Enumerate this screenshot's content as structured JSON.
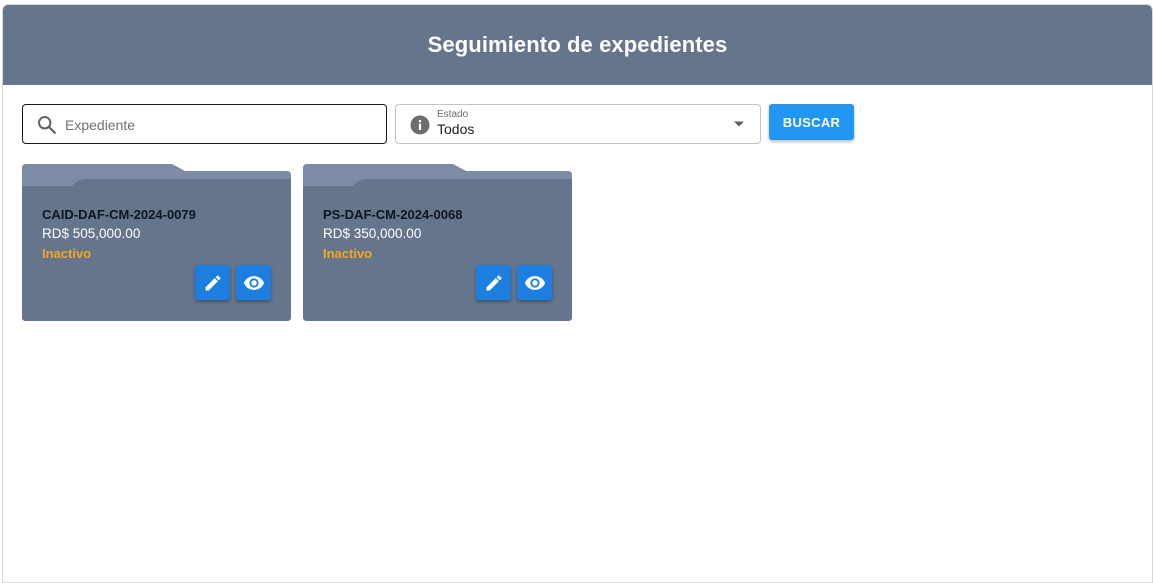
{
  "header": {
    "title": "Seguimiento de expedientes"
  },
  "search": {
    "placeholder": "Expediente",
    "value": ""
  },
  "estado": {
    "label": "Estado",
    "value": "Todos"
  },
  "buscar_label": "BUSCAR",
  "cards": [
    {
      "code": "CAID-DAF-CM-2024-0079",
      "amount": "RD$ 505,000.00",
      "status": "Inactivo"
    },
    {
      "code": "PS-DAF-CM-2024-0068",
      "amount": "RD$ 350,000.00",
      "status": "Inactivo"
    }
  ],
  "colors": {
    "header": "#65758c",
    "card": "#65758c",
    "card_tab": "#7c8ca6",
    "status_inactive": "#f5a623",
    "accent": "#2196f3",
    "action_button": "#1c7fe0"
  },
  "icons": {
    "search": "search-icon",
    "info": "info-icon",
    "dropdown": "chevron-down-icon",
    "edit": "pencil-icon",
    "view": "eye-icon"
  }
}
